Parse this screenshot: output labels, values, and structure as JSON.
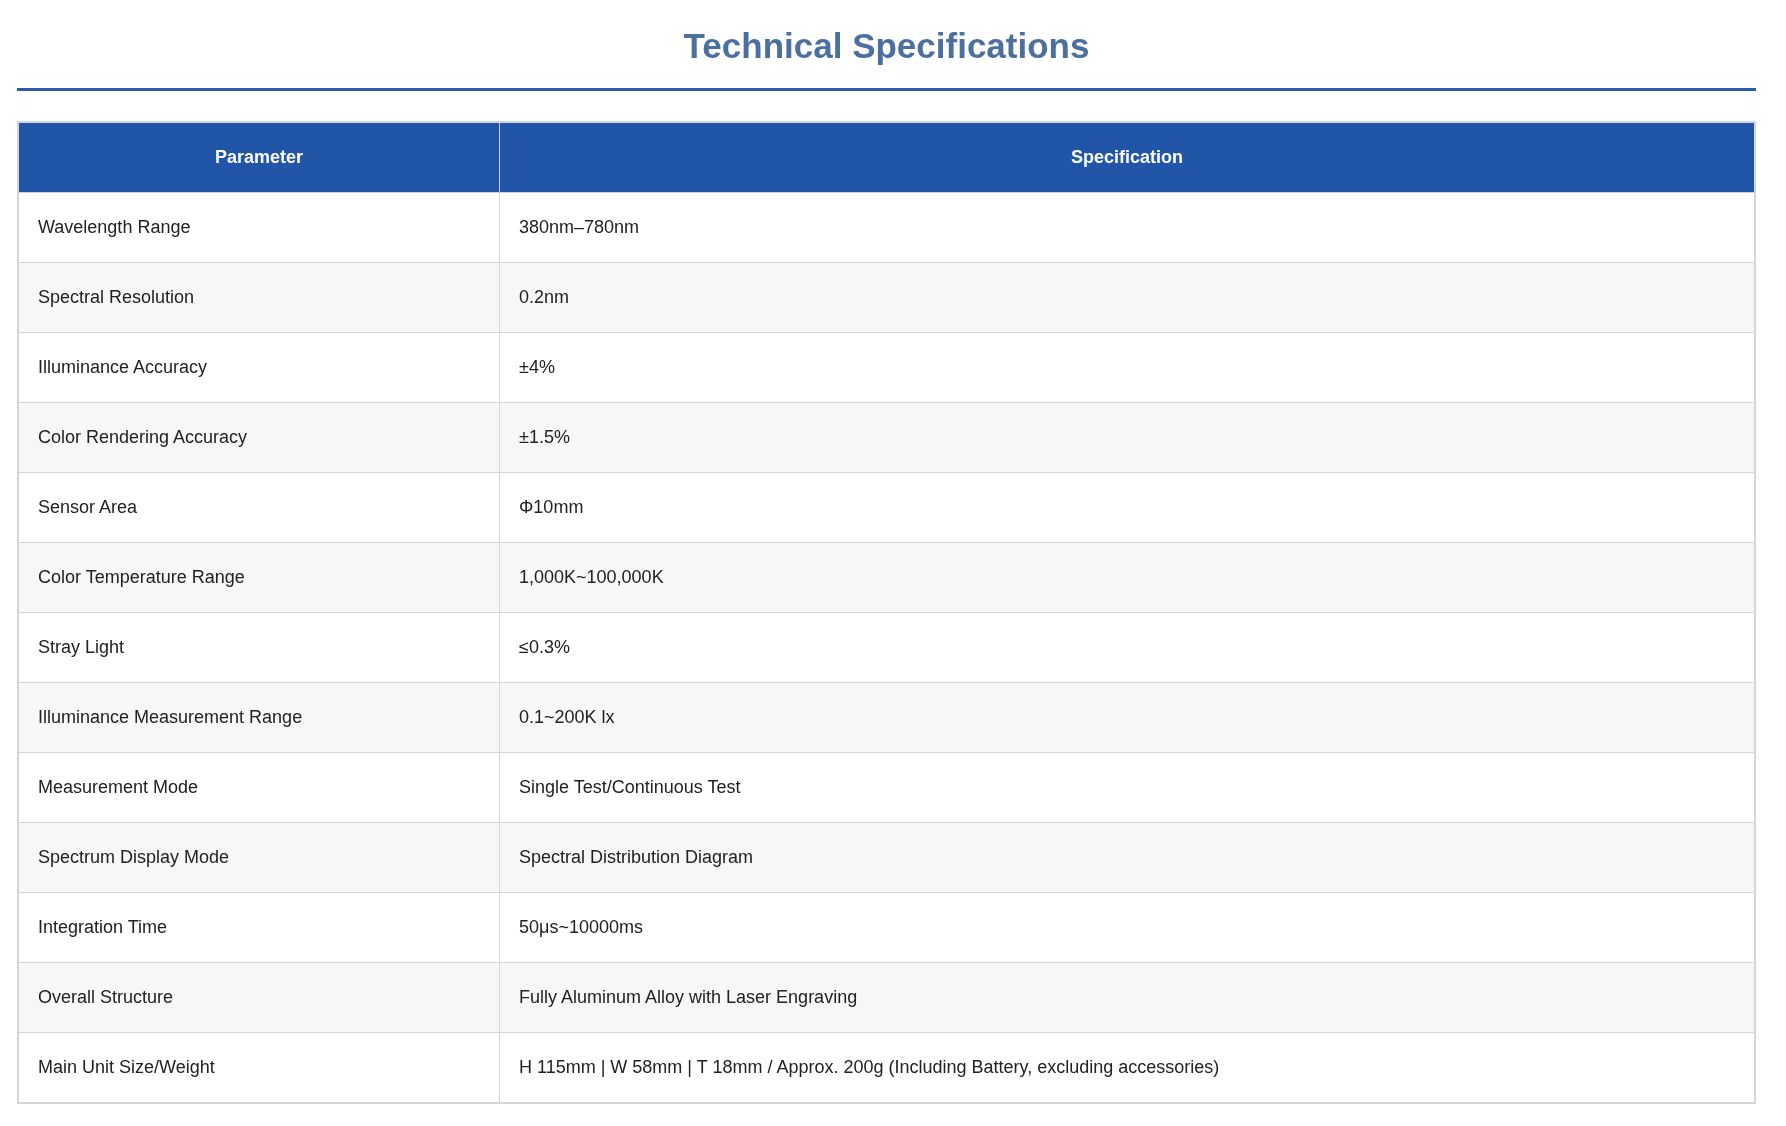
{
  "title": "Technical Specifications",
  "table": {
    "columns": [
      "Parameter",
      "Specification"
    ],
    "rows": [
      [
        "Wavelength Range",
        "380nm–780nm"
      ],
      [
        "Spectral Resolution",
        "0.2nm"
      ],
      [
        "Illuminance Accuracy",
        "±4%"
      ],
      [
        "Color Rendering Accuracy",
        "±1.5%"
      ],
      [
        "Sensor Area",
        "Φ10mm"
      ],
      [
        "Color Temperature Range",
        "1,000K~100,000K"
      ],
      [
        "Stray Light",
        "≤0.3%"
      ],
      [
        "Illuminance Measurement Range",
        "0.1~200K lx"
      ],
      [
        "Measurement Mode",
        "Single Test/Continuous Test"
      ],
      [
        "Spectrum Display Mode",
        "Spectral Distribution Diagram"
      ],
      [
        "Integration Time",
        "50μs~10000ms"
      ],
      [
        "Overall Structure",
        "Fully Aluminum Alloy with Laser Engraving"
      ],
      [
        "Main Unit Size/Weight",
        "H 115mm | W 58mm | T 18mm / Approx. 200g (Including Battery, excluding accessories)"
      ]
    ]
  }
}
